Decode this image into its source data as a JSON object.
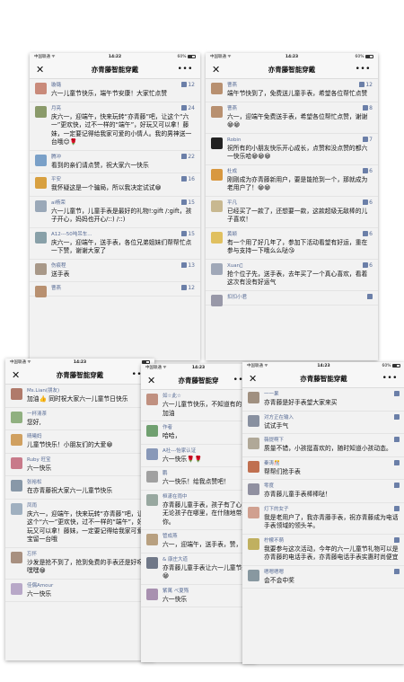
{
  "colors": {
    "name": "#576b95",
    "bg": "#f2f2f2",
    "text": "#111111"
  },
  "screens": [
    {
      "status": {
        "carrier": "中国联通",
        "wifi": "wifi-icon",
        "time": "14:22",
        "battery": "60%"
      },
      "title": "亦青藤智能穿戴",
      "comments": [
        {
          "name": "璇璐",
          "text": "六一儿童节快乐，端午节安康！大家忙点赞",
          "likes": "12",
          "av": "#c98a7a"
        },
        {
          "name": "月亮",
          "text": "庆六一，迎端午，快来玩转“亦青藤”吧，让这个“六一”更欢快，过不一样的“端午”，好玩又可以拿！藤妹，一定要记得给我家可爱的小情人。我的男神送一台哦😊🌹",
          "likes": "24",
          "av": "#8a9a6a"
        },
        {
          "name": "腾冲",
          "text": "看到的亲们请点赞，祝大家六一快乐",
          "likes": "22",
          "av": "#7aa0c8"
        },
        {
          "name": "平安",
          "text": "我怀疑这是一个骗局，所以我决定试试😁",
          "likes": "16",
          "av": "#d8a040"
        },
        {
          "name": "ai杨荣",
          "text": "六一儿童节，儿童手表是最好的礼物!:gift /:gift，孩子开心，妈妈也开心/::) /::)",
          "likes": "15",
          "av": "#9aa8b8"
        },
        {
          "name": "A12---50吨吊车...",
          "text": "庆六一，迎端午，送手表，各位兄弟姐妹们帮帮忙点一下赞，谢谢大家了",
          "likes": "15",
          "av": "#88a0a8"
        },
        {
          "name": "伤痕程",
          "text": "送手表",
          "likes": "13",
          "av": "#a89888"
        },
        {
          "name": "曹燕",
          "text": "",
          "likes": "12",
          "av": "#b89070"
        }
      ]
    },
    {
      "status": {
        "carrier": "中国联通",
        "wifi": "wifi-icon",
        "time": "14:23",
        "battery": "60%"
      },
      "title": "亦青藤智能穿戴",
      "comments": [
        {
          "name": "曹燕",
          "text": "端午节快到了，免费送儿童手表，希望各位帮忙点赞",
          "likes": "12",
          "av": "#b89070"
        },
        {
          "name": "曹燕",
          "text": "六一，迎端午免费送手表，希望各位帮忙点赞，谢谢😁😁",
          "likes": "8",
          "av": "#b89070"
        },
        {
          "name": "Robin",
          "text": "祝所有的小朋友快乐开心成长，点赞和没点赞的都六一快乐哈😁😁😁",
          "likes": "7",
          "av": "#222222"
        },
        {
          "name": "杜成",
          "text": "刚刚成为亦青藤新用户，要是能抢到一个，那就成为老用户了！😁😁",
          "likes": "6",
          "av": "#d89840"
        },
        {
          "name": "平凡",
          "text": "已经买了一款了，还想要一款，这款超级无敌棒的儿子喜欢！",
          "likes": "6",
          "av": "#c8b890"
        },
        {
          "name": "黄颖",
          "text": "有一个用了好几年了，参加下活动看望有好运，重在参与支持一下哦么么哒😘",
          "likes": "6",
          "av": "#e0c060"
        },
        {
          "name": "Xuan，̈",
          "text": "抢个位子先，送手表，去年买了一个真心喜欢，看着这次有没有好运气",
          "likes": "6",
          "av": "#a0a8b8"
        },
        {
          "name": "扣扣小君",
          "text": "",
          "likes": "",
          "av": "#9898a8"
        }
      ]
    },
    {
      "status": {
        "carrier": "中国联通",
        "wifi": "wifi-icon",
        "time": "14:23",
        "battery": ""
      },
      "title": "亦青藤智能穿戴",
      "comments": [
        {
          "name": "Ms.Lian(朋友)",
          "text": "加油👍 同时祝大家六一儿童节日快乐",
          "likes": "",
          "av": "#b07a6a"
        },
        {
          "name": "一杯清茶",
          "text": "您好,",
          "likes": "",
          "av": "#90b080"
        },
        {
          "name": "晴曦妈",
          "text": "儿童节快乐！小朋友们的大爱😁",
          "likes": "",
          "av": "#d0a060"
        },
        {
          "name": "Ruby 旺宝",
          "text": "六一快乐",
          "likes": "",
          "av": "#c87a8a"
        },
        {
          "name": "张裕松",
          "text": "在亦青藤祝大家六一儿童节快乐",
          "likes": "",
          "av": "#8898a8"
        },
        {
          "name": "凤雨",
          "text": "庆六一，迎端午，快来玩转“亦青藤”吧，让这个“六一”更欢快，过不一样的“端午”，好玩又可以拿！藤妹，一定要记得给我家可爱的宝留一台哦",
          "likes": "",
          "av": "#a0b0c0"
        },
        {
          "name": "忘怀",
          "text": "沙发是抢不到了，抢到免费的手表还是好呀，嘿嘿😁",
          "likes": "",
          "av": "#a89080"
        },
        {
          "name": "佳偶Amour",
          "text": "六一快乐",
          "likes": "",
          "av": "#b8a8c8"
        }
      ]
    },
    {
      "status": {
        "carrier": "中国联通",
        "wifi": "wifi-icon",
        "time": "14:23",
        "battery": ""
      },
      "title": "亦青藤智能穿",
      "comments": [
        {
          "name": "如☆此☆",
          "text": "六一儿童节快乐，不知道有的，加油",
          "likes": "",
          "av": "#c09080"
        },
        {
          "name": "作者",
          "text": "哈哈，",
          "likes": "",
          "av": "#70a070"
        },
        {
          "name": "A社---怡家认证",
          "text": "六一快乐🌹🌹",
          "likes": "",
          "av": "#8898b8"
        },
        {
          "name": "鹏",
          "text": "六一快乐！给我点赞吧！",
          "likes": "",
          "av": "#a0a0a0"
        },
        {
          "name": "桓漾在雨中",
          "text": "亦青藤儿童手表，孩子有了心！无论孩子在哪里，在什随地带着你。",
          "likes": "",
          "av": "#98a8a0"
        },
        {
          "name": "管成燕",
          "text": "六一，迎端午，送手表，赞，",
          "likes": "",
          "av": "#b8a080"
        },
        {
          "name": "& 康庄大道",
          "text": "亦青藤儿童手表让六一儿童节无😁",
          "likes": "",
          "av": "#707888"
        },
        {
          "name": "紫萬 べ夏殇",
          "text": "六一快乐",
          "likes": "",
          "av": "#a890b0"
        }
      ]
    },
    {
      "status": {
        "carrier": "中国联通",
        "wifi": "wifi-icon",
        "time": "14:23",
        "battery": "60%"
      },
      "title": "亦青藤智能穿戴",
      "comments": [
        {
          "name": "一一果",
          "text": "亦青藤是好手表望大家来买",
          "likes": "",
          "av": "#a09080"
        },
        {
          "name": "对方正在输入",
          "text": "试试手气",
          "likes": "",
          "av": "#8890a0"
        },
        {
          "name": "薇提啊下",
          "text": "质量不错，小孩挺喜欢的，随时知道小孩动态。",
          "likes": "",
          "av": "#b0a898"
        },
        {
          "name": "秦涛🎊",
          "text": "帮帮们抢手表",
          "likes": "",
          "av": "#c07050"
        },
        {
          "name": "零度",
          "text": "亦青藤儿童手表棒棒哒！",
          "likes": "",
          "av": "#9090a0"
        },
        {
          "name": "灯下的女子",
          "text": "我是老用户了，我亦青藤手表，祝亦青藤成为电话手表领域的领头羊。",
          "likes": "",
          "av": "#d0a090"
        },
        {
          "name": "柠檬不萌",
          "text": "我要参与这次活动，今年的六一儿童节礼物可以是亦青藤的电话手表，亦青藤电话手表实惠时尚便宜",
          "likes": "",
          "av": "#c0b060"
        },
        {
          "name": "嗯嗯嗯嗯",
          "text": "会不会中奖",
          "likes": "",
          "av": "#8898a0"
        }
      ]
    }
  ]
}
